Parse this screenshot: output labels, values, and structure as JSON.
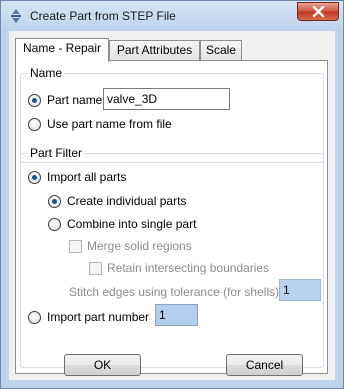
{
  "window": {
    "title": "Create Part from STEP File"
  },
  "tabs": [
    {
      "label": "Name - Repair"
    },
    {
      "label": "Part Attributes"
    },
    {
      "label": "Scale"
    }
  ],
  "name_group": {
    "title": "Name",
    "part_name_label": "Part name",
    "part_name_value": "valve_3D",
    "use_file_name_label": "Use part name from file"
  },
  "part_filter": {
    "title": "Part Filter",
    "import_all_label": "Import all parts",
    "create_individual_label": "Create individual parts",
    "combine_label": "Combine into single part",
    "merge_label": "Merge solid regions",
    "retain_label": "Retain intersecting boundaries",
    "stitch_label": "Stitch edges using tolerance (for shells)",
    "stitch_value": "1",
    "import_number_label": "Import part number",
    "import_number_value": "1"
  },
  "buttons": {
    "ok": "OK",
    "cancel": "Cancel"
  }
}
